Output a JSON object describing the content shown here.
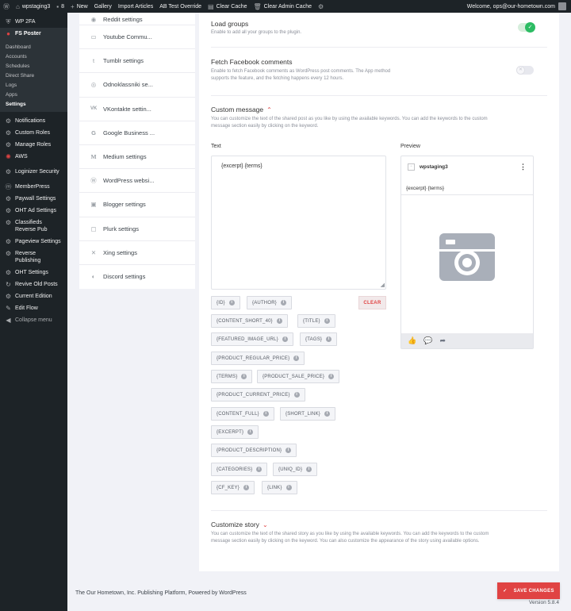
{
  "adminbar": {
    "site": "wpstaging3",
    "comments_count": "8",
    "new": "New",
    "gallery": "Gallery",
    "import_articles": "Import Articles",
    "ab_test": "AB Test Override",
    "clear_cache": "Clear Cache",
    "clear_admin_cache": "Clear Admin Cache",
    "welcome": "Welcome, ops@our-hometown.com"
  },
  "menu": {
    "items_top": [
      {
        "label": "WP 2FA",
        "icon": "shield-icon"
      },
      {
        "label": "FS Poster",
        "icon": "fs-poster-icon"
      }
    ],
    "submenu": [
      "Dashboard",
      "Accounts",
      "Schedules",
      "Direct Share",
      "Logs",
      "Apps",
      "Settings"
    ],
    "items": [
      {
        "label": "Notifications",
        "icon": "gear-icon"
      },
      {
        "label": "Custom Roles",
        "icon": "gear-icon"
      },
      {
        "label": "Manage Roles",
        "icon": "gear-icon"
      },
      {
        "label": "AWS",
        "icon": "aws-icon"
      },
      {
        "label": "Loginizer Security",
        "icon": "gear-icon"
      },
      {
        "label": "MemberPress",
        "icon": "memberpress-icon"
      },
      {
        "label": "Paywall Settings",
        "icon": "gear-icon"
      },
      {
        "label": "OHT Ad Settings",
        "icon": "gear-icon"
      },
      {
        "label": "Classifieds Reverse Pub",
        "icon": "gear-icon"
      },
      {
        "label": "Pageview Settings",
        "icon": "gear-icon"
      },
      {
        "label": "Reverse Publishing",
        "icon": "gear-icon"
      },
      {
        "label": "OHT Settings",
        "icon": "gear-icon"
      },
      {
        "label": "Revive Old Posts",
        "icon": "revive-icon"
      },
      {
        "label": "Current Edition",
        "icon": "gear-icon"
      },
      {
        "label": "Edit Flow",
        "icon": "pencil-icon"
      }
    ],
    "collapse": "Collapse menu"
  },
  "settings_list": {
    "partial": "Reddit settings",
    "rows": [
      {
        "label": "Youtube Commu...",
        "icon": "youtube-icon"
      },
      {
        "label": "Tumblr settings",
        "icon": "tumblr-icon"
      },
      {
        "label": "Odnoklassniki se...",
        "icon": "odnoklassniki-icon"
      },
      {
        "label": "VKontakte settin...",
        "icon": "vk-icon"
      },
      {
        "label": "Google Business ...",
        "icon": "google-icon"
      },
      {
        "label": "Medium settings",
        "icon": "medium-icon"
      },
      {
        "label": "WordPress websi...",
        "icon": "wordpress-icon"
      },
      {
        "label": "Blogger settings",
        "icon": "blogger-icon"
      },
      {
        "label": "Plurk settings",
        "icon": "plurk-icon"
      },
      {
        "label": "Xing settings",
        "icon": "xing-icon"
      },
      {
        "label": "Discord settings",
        "icon": "discord-icon"
      }
    ]
  },
  "main": {
    "load_groups": {
      "title": "Load groups",
      "desc": "Enable to add all your groups to the plugin.",
      "enabled": true
    },
    "fetch_comments": {
      "title": "Fetch Facebook comments",
      "desc1": "Enable to fetch Facebook comments as WordPress post comments. The App method",
      "desc2": "supports the feature, and the fetching happens every 12 hours.",
      "enabled": false
    },
    "custom_message": {
      "title": "Custom message",
      "desc1": "You can customize the text of the shared post as you like by using the available keywords. You can add the keywords to the custom",
      "desc2": "message section easily by clicking on the keyword.",
      "text_label": "Text",
      "preview_label": "Preview",
      "text_value": "{excerpt} {terms}",
      "preview_account": "wpstaging3",
      "preview_text": "{excerpt} {terms}",
      "clear": "CLEAR",
      "keywords": [
        "{ID}",
        "{AUTHOR}",
        "{CONTENT_SHORT_40}",
        "{TITLE}",
        "{FEATURED_IMAGE_URL}",
        "{TAGS}",
        "{PRODUCT_REGULAR_PRICE}",
        "{TERMS}",
        "{PRODUCT_SALE_PRICE}",
        "{PRODUCT_CURRENT_PRICE}",
        "{CONTENT_FULL}",
        "{SHORT_LINK}",
        "{EXCERPT}",
        "{PRODUCT_DESCRIPTION}",
        "{CATEGORIES}",
        "{UNIQ_ID}",
        "{CF_KEY}",
        "{LINK}"
      ]
    },
    "customize_story": {
      "title": "Customize story",
      "desc1": "You can customize the text of the shared story as you like by using the available keywords. You can add the keywords to the custom",
      "desc2": "message section easily by clicking on the keyword. You can also customize the appearance of the story using available options."
    }
  },
  "footer": {
    "text": "The Our Hometown, Inc. Publishing Platform, Powered by WordPress",
    "save": "SAVE CHANGES",
    "version": "Version 5.8.4"
  },
  "colors": {
    "accent": "#e04343",
    "toggle_on": "#2cbc63",
    "admin_bg": "#1d2327"
  }
}
